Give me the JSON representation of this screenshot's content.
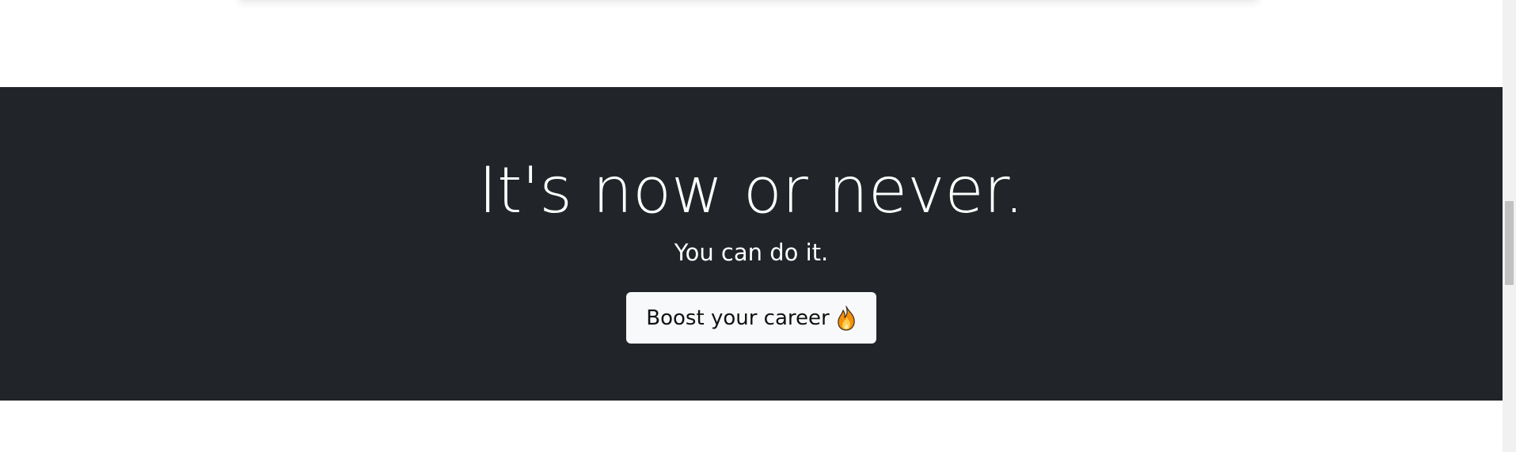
{
  "cta": {
    "title": "It's now or never.",
    "subtitle": "You can do it.",
    "button_label": "Boost your career",
    "button_icon": "fire-icon"
  },
  "colors": {
    "section_bg": "#212529",
    "button_bg": "#f8f9fa",
    "text_light": "#ffffff",
    "text_dark": "#111111"
  }
}
